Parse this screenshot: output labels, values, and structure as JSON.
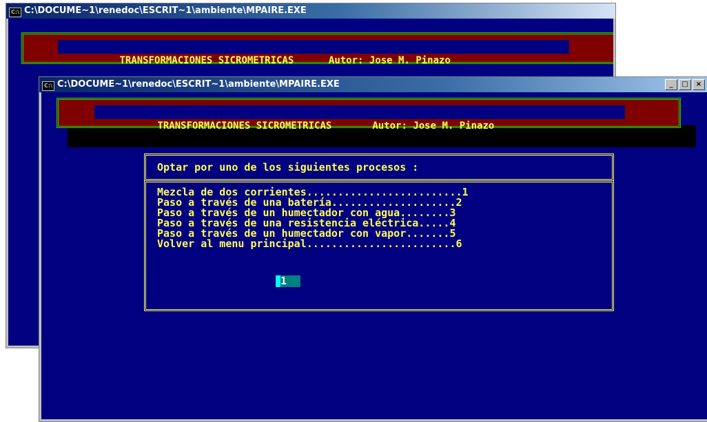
{
  "back_window": {
    "title": "C:\\DOCUME~1\\renedoc\\ESCRIT~1\\ambiente\\MPAIRE.EXE",
    "icon": "console-icon",
    "banner_title": "TRANSFORMACIONES SICROMETRICAS",
    "banner_author": "Autor: Jose M. Pinazo"
  },
  "front_window": {
    "title": "C:\\DOCUME~1\\renedoc\\ESCRIT~1\\ambiente\\MPAIRE.EXE",
    "icon": "console-icon",
    "buttons": {
      "minimize": "_",
      "maximize": "□",
      "close": "×"
    },
    "banner_title": "TRANSFORMACIONES SICROMETRICAS",
    "banner_author": "Autor: Jose M. Pinazo",
    "menu": {
      "header": "Optar por uno de los siguientes procesos :",
      "items": [
        "Mezcla de dos corrientes.........................1",
        "Paso a través de una batería....................2",
        "Paso a través de un humectador con agua........3",
        "Paso a través de una resistencia eléctrica.....4",
        "Paso a través de un humectador con vapor.......5",
        "Volver al menu principal........................6"
      ],
      "input_value": "1"
    }
  },
  "colors": {
    "console_bg": "#000080",
    "text_yellow": "#ffff55",
    "banner_red": "#800000",
    "banner_green": "#00e000"
  }
}
